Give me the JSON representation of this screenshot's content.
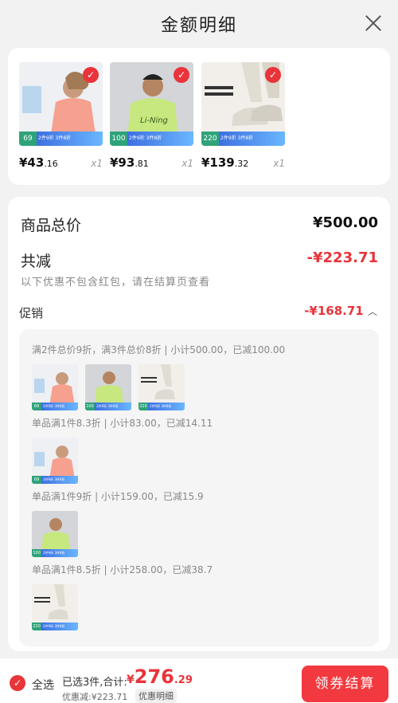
{
  "header": {
    "title": "金额明细"
  },
  "products": [
    {
      "count_tag": "69",
      "promo_tag": "2件9折 3件8折",
      "price_int": "¥43",
      "price_dec": ".16",
      "qty": "x1",
      "color": "#f6a08f",
      "bg": "#e9ebef"
    },
    {
      "count_tag": "100",
      "promo_tag": "2件9折 3件8折",
      "price_int": "¥93",
      "price_dec": ".81",
      "qty": "x1",
      "color": "#c6e87f",
      "bg": "#cfd1d4"
    },
    {
      "count_tag": "220",
      "promo_tag": "2件9折 3件8折",
      "price_int": "¥139",
      "price_dec": ".32",
      "qty": "x1",
      "color": "#e3ded5",
      "bg": "#f1eee9"
    }
  ],
  "summary": {
    "goods_total_label": "商品总价",
    "goods_total_value": "¥500.00",
    "reduction_label": "共减",
    "reduction_value": "-¥223.71",
    "note": "以下优惠不包含红包，请在结算页查看",
    "promotion_label": "促销",
    "promotion_value": "-¥168.71"
  },
  "promotion_details": [
    "满2件总价9折，满3件总价8折 | 小计500.00，已减100.00",
    "单品满1件8.3折 | 小计83.00，已减14.11",
    "单品满1件9折 | 小计159.00，已减15.9",
    "单品满1件8.5折 | 小计258.00，已减38.7"
  ],
  "footer": {
    "select_all_label": "全选",
    "selected_text": "已选3件,合计:",
    "total_yen": "¥",
    "total_int": "276",
    "total_dec": ".29",
    "discount_text": "优惠减:¥223.71",
    "detail_button": "优惠明细",
    "checkout_button": "领券结算"
  },
  "icons": {
    "check": "checkmark-icon",
    "close": "close-icon",
    "chevron": "chevron-up-icon"
  },
  "colors": {
    "accent": "#e8343a",
    "tag_green": "#2fa37a",
    "tag_blue": "#3d6fe0"
  }
}
